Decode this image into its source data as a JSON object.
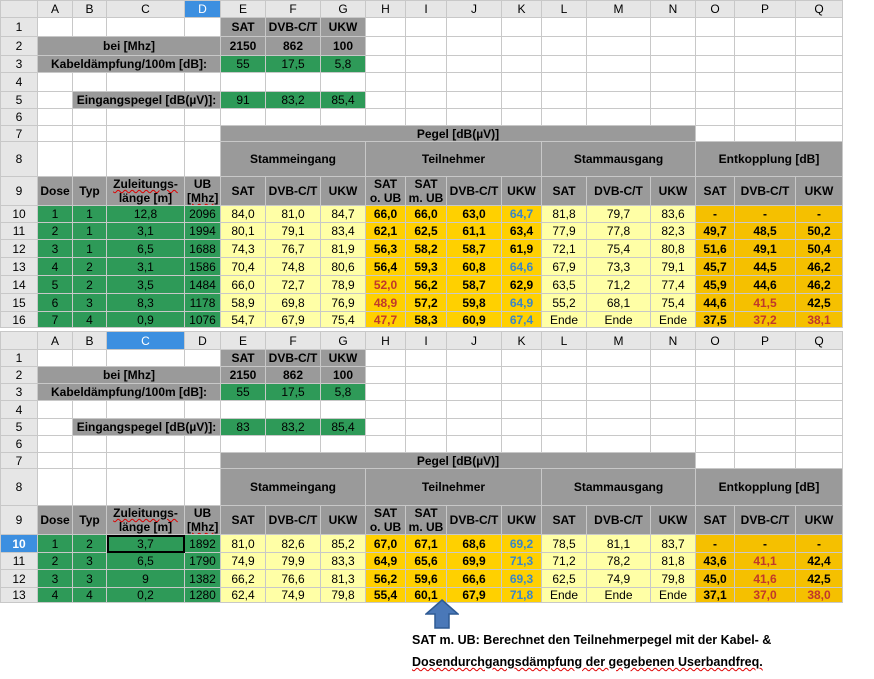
{
  "columns": [
    "A",
    "B",
    "C",
    "D",
    "E",
    "F",
    "G",
    "H",
    "I",
    "J",
    "K",
    "L",
    "M",
    "N",
    "O",
    "P",
    "Q"
  ],
  "rows1": [
    "1",
    "2",
    "3",
    "4",
    "5",
    "6",
    "7",
    "8",
    "9",
    "10",
    "11",
    "12",
    "13",
    "14",
    "15",
    "16"
  ],
  "rows2": [
    "1",
    "2",
    "3",
    "4",
    "5",
    "6",
    "7",
    "8",
    "9",
    "10",
    "11",
    "12",
    "13"
  ],
  "freq_header": [
    "SAT",
    "DVB-C/T",
    "UKW"
  ],
  "bei_label": "bei [Mhz]",
  "freq_values": [
    "2150",
    "862",
    "100"
  ],
  "kabel_label": "Kabeldämpfung/100m [dB]:",
  "kabel_values": [
    "55",
    "17,5",
    "5,8"
  ],
  "eingang_label": "Eingangspegel [dB(µV)]:",
  "pegel_header": "Pegel [dB(µV)]",
  "groups": {
    "stamm_ein": "Stammeingang",
    "teil": "Teilnehmer",
    "stamm_aus": "Stammausgang",
    "entk": "Entkopplung [dB]"
  },
  "col_heads": {
    "dose": "Dose",
    "typ": "Typ",
    "zul1": "Zuleitungs-",
    "zul2": "länge [m]",
    "ub1": "UB",
    "ub2": "[Mhz]",
    "sat": "SAT",
    "dvb": "DVB-C/T",
    "ukw": "UKW",
    "satoub1": "SAT",
    "satoub2": "o. UB",
    "satmub1": "SAT",
    "satmub2": "m. UB"
  },
  "table1": {
    "eingang_values": [
      "91",
      "83,2",
      "85,4"
    ],
    "rows": [
      [
        "1",
        "1",
        "12,8",
        "2096",
        "84,0",
        "81,0",
        "84,7",
        "66,0",
        "66,0",
        "63,0",
        "64,7",
        "81,8",
        "79,7",
        "83,6",
        "-",
        "-",
        "-"
      ],
      [
        "2",
        "1",
        "3,1",
        "1994",
        "80,1",
        "79,1",
        "83,4",
        "62,1",
        "62,5",
        "61,1",
        "63,4",
        "77,9",
        "77,8",
        "82,3",
        "49,7",
        "48,5",
        "50,2"
      ],
      [
        "3",
        "1",
        "6,5",
        "1688",
        "74,3",
        "76,7",
        "81,9",
        "56,3",
        "58,2",
        "58,7",
        "61,9",
        "72,1",
        "75,4",
        "80,8",
        "51,6",
        "49,1",
        "50,4"
      ],
      [
        "4",
        "2",
        "3,1",
        "1586",
        "70,4",
        "74,8",
        "80,6",
        "56,4",
        "59,3",
        "60,8",
        "64,6",
        "67,9",
        "73,3",
        "79,1",
        "45,7",
        "44,5",
        "46,2"
      ],
      [
        "5",
        "2",
        "3,5",
        "1484",
        "66,0",
        "72,7",
        "78,9",
        "52,0",
        "56,2",
        "58,7",
        "62,9",
        "63,5",
        "71,2",
        "77,4",
        "45,9",
        "44,6",
        "46,2"
      ],
      [
        "6",
        "3",
        "8,3",
        "1178",
        "58,9",
        "69,8",
        "76,9",
        "48,9",
        "57,2",
        "59,8",
        "64,9",
        "55,2",
        "68,1",
        "75,4",
        "44,6",
        "41,5",
        "42,5"
      ],
      [
        "7",
        "4",
        "0,9",
        "1076",
        "54,7",
        "67,9",
        "75,4",
        "47,7",
        "58,3",
        "60,9",
        "67,4",
        "Ende",
        "Ende",
        "Ende",
        "37,5",
        "37,2",
        "38,1"
      ]
    ]
  },
  "table2": {
    "eingang_values": [
      "83",
      "83,2",
      "85,4"
    ],
    "rows": [
      [
        "1",
        "2",
        "3,7",
        "1892",
        "81,0",
        "82,6",
        "85,2",
        "67,0",
        "67,1",
        "68,6",
        "69,2",
        "78,5",
        "81,1",
        "83,7",
        "-",
        "-",
        "-"
      ],
      [
        "2",
        "3",
        "6,5",
        "1790",
        "74,9",
        "79,9",
        "83,3",
        "64,9",
        "65,6",
        "69,9",
        "71,3",
        "71,2",
        "78,2",
        "81,8",
        "43,6",
        "41,1",
        "42,4"
      ],
      [
        "3",
        "3",
        "9",
        "1382",
        "66,2",
        "76,6",
        "81,3",
        "56,2",
        "59,6",
        "66,6",
        "69,3",
        "62,5",
        "74,9",
        "79,8",
        "45,0",
        "41,6",
        "42,5"
      ],
      [
        "4",
        "4",
        "0,2",
        "1280",
        "62,4",
        "74,9",
        "79,8",
        "55,4",
        "60,1",
        "67,9",
        "71,8",
        "Ende",
        "Ende",
        "Ende",
        "37,1",
        "37,0",
        "38,0"
      ]
    ]
  },
  "note_line1": "SAT m. UB: Berechnet den Teilnehmerpegel mit der Kabel- &",
  "note_line2": "Dosendurchgangsdämpfung der gegebenen Userbandfreq.",
  "colors": {
    "green": "#2e9a58",
    "gray_header": "#9a9a9a",
    "light_yellow": "#ffffa6",
    "gold": "#ffd000",
    "red_text": "#c0392b",
    "blue_text": "#3a86c8",
    "selection": "#3c8fe0"
  }
}
